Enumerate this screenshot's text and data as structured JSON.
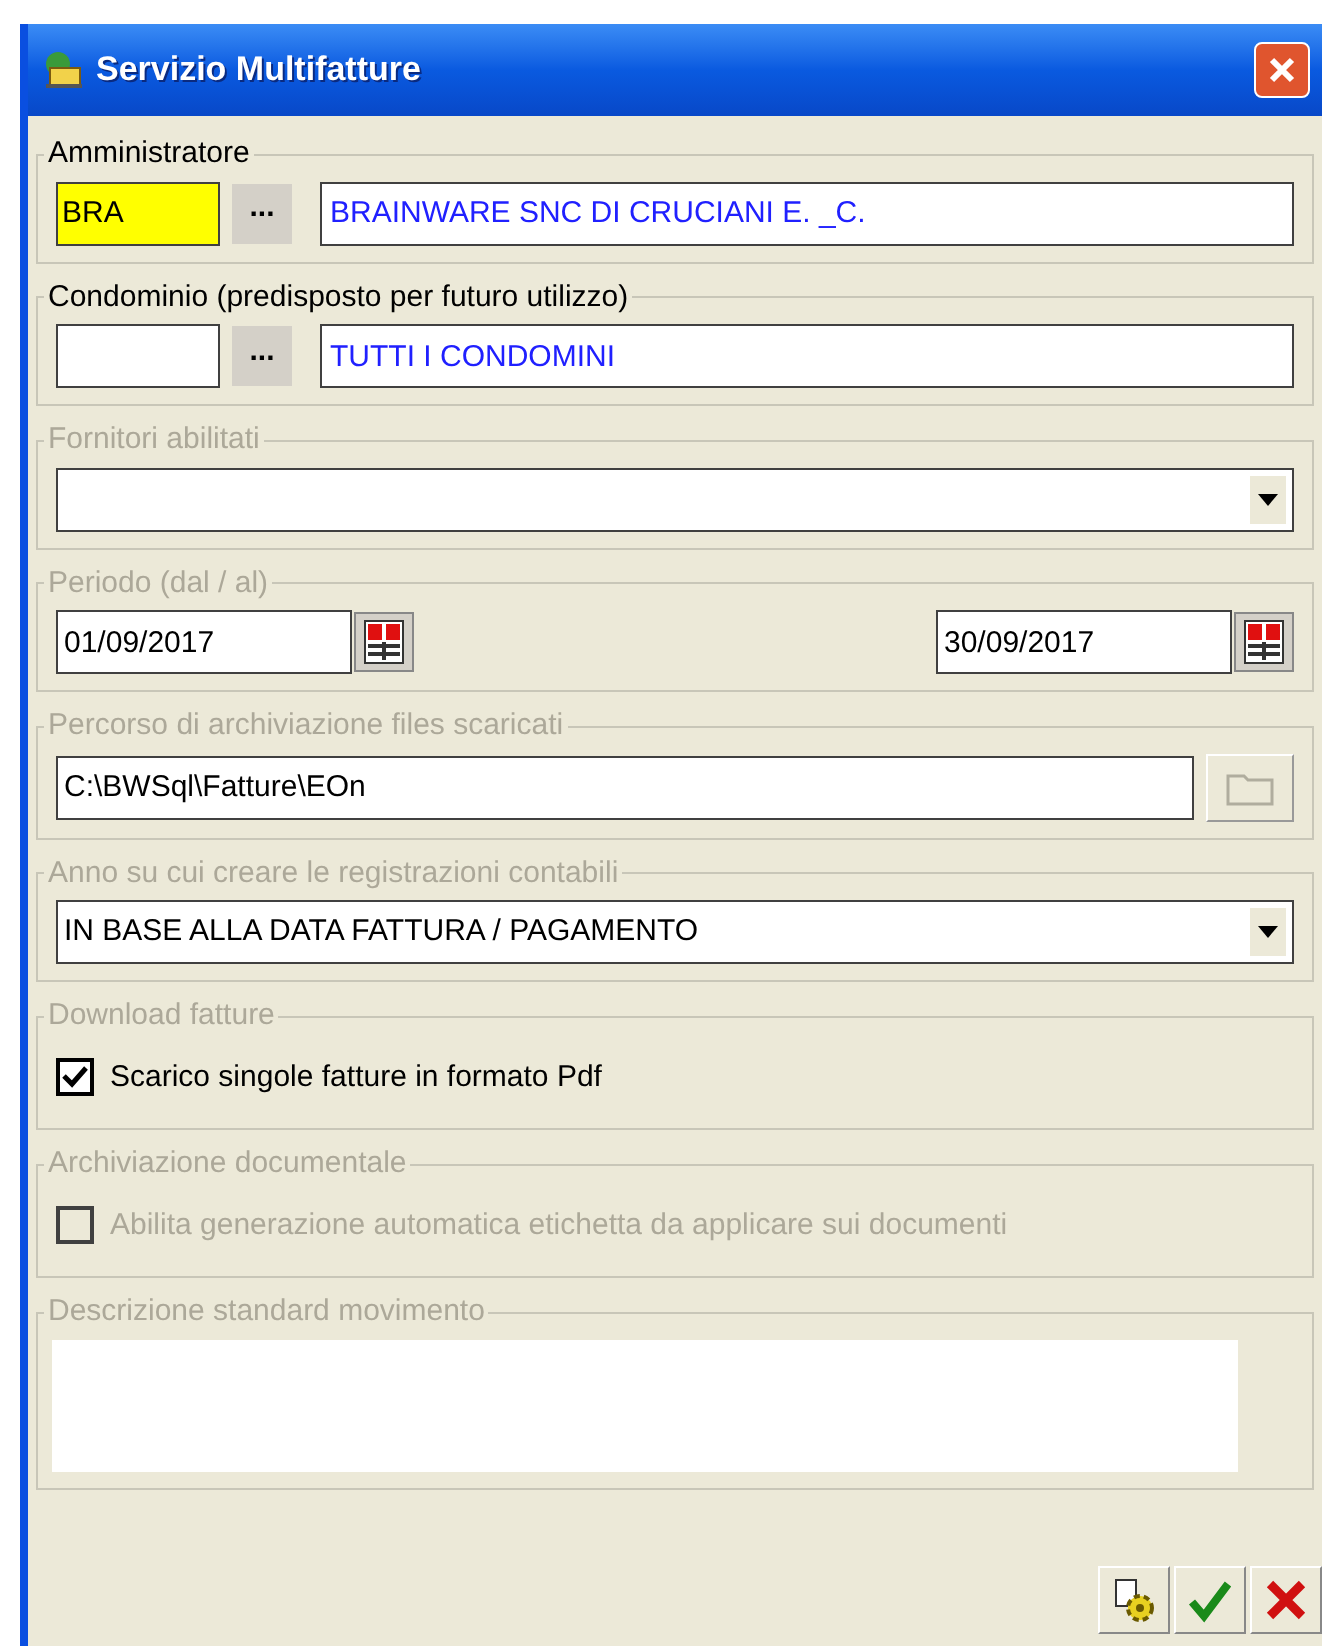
{
  "window": {
    "title": "Servizio Multifatture"
  },
  "groups": [
    {
      "kind": "lookup",
      "title": "Amministratore",
      "disabled": false,
      "code": "BRA",
      "highlighted": true,
      "button": "...",
      "description": "BRAINWARE SNC DI CRUCIANI E. _C."
    },
    {
      "kind": "lookup",
      "title": "Condominio (predisposto per futuro utilizzo)",
      "disabled": false,
      "highlighted": false,
      "button": "...",
      "description": "TUTTI I CONDOMINI"
    },
    {
      "kind": "combo",
      "title": "Fornitori abilitati",
      "disabled": true
    },
    {
      "kind": "dates",
      "title": "Periodo (dal / al)",
      "disabled": true,
      "from": "01/09/2017",
      "to": "30/09/2017"
    },
    {
      "kind": "path",
      "title": "Percorso di archiviazione files scaricati",
      "disabled": true,
      "value": "C:\\BWSql\\Fatture\\EOn"
    },
    {
      "kind": "combo",
      "title": "Anno su cui creare le registrazioni contabili",
      "disabled": true,
      "value": "IN BASE ALLA DATA FATTURA / PAGAMENTO"
    },
    {
      "kind": "checkbox",
      "title": "Download fatture",
      "disabled": true,
      "label": "Scarico singole fatture in formato Pdf",
      "checked": true,
      "checkbox_disabled": false
    },
    {
      "kind": "checkbox",
      "title": "Archiviazione documentale",
      "disabled": true,
      "label": "Abilita generazione automatica etichetta da applicare sui documenti",
      "checked": false,
      "checkbox_disabled": true
    },
    {
      "kind": "memo",
      "title": "Descrizione standard movimento",
      "disabled": true
    }
  ]
}
